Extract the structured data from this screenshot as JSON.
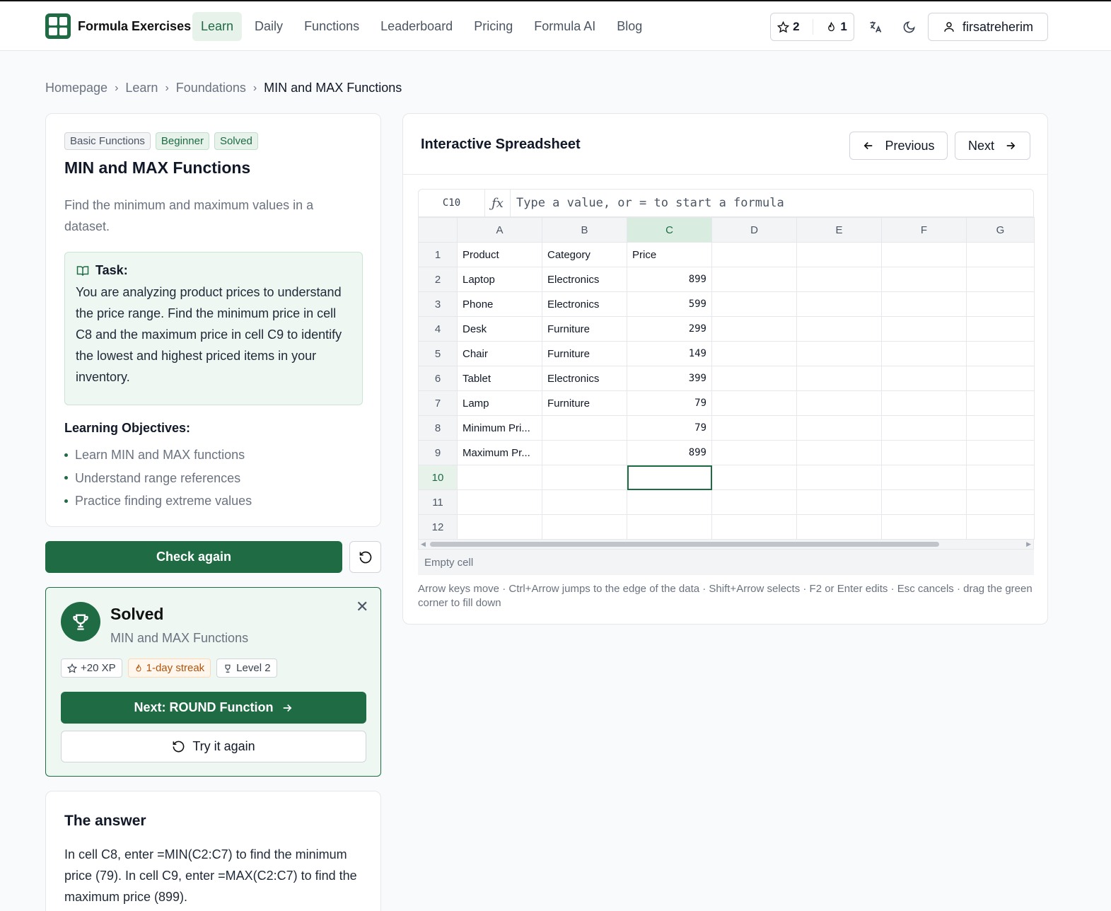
{
  "brand": {
    "name": "Formula Exercises"
  },
  "nav": [
    {
      "label": "Learn",
      "active": true
    },
    {
      "label": "Daily"
    },
    {
      "label": "Functions"
    },
    {
      "label": "Leaderboard"
    },
    {
      "label": "Pricing"
    },
    {
      "label": "Formula AI"
    },
    {
      "label": "Blog"
    }
  ],
  "stats": {
    "xp": "2",
    "streak": "1"
  },
  "user": {
    "name": "firsatreherim"
  },
  "breadcrumb": [
    "Homepage",
    "Learn",
    "Foundations",
    "MIN and MAX Functions"
  ],
  "task": {
    "badges": [
      "Basic Functions",
      "Beginner",
      "Solved"
    ],
    "title": "MIN and MAX Functions",
    "description": "Find the minimum and maximum values in a dataset.",
    "box_heading": "Task:",
    "box_text": "You are analyzing product prices to understand the price range. Find the minimum price in cell C8 and the maximum price in cell C9 to identify the lowest and highest priced items in your inventory.",
    "objectives_title": "Learning Objectives:",
    "objectives": [
      "Learn MIN and MAX functions",
      "Understand range references",
      "Practice finding extreme values"
    ]
  },
  "actions": {
    "check_label": "Check again"
  },
  "solved": {
    "title": "Solved",
    "subtitle": "MIN and MAX Functions",
    "chips": [
      "+20 XP",
      "1-day streak",
      "Level 2"
    ],
    "next_label": "Next: ROUND Function",
    "retry_label": "Try it again"
  },
  "answer": {
    "title": "The answer",
    "text": "In cell C8, enter =MIN(C2:C7) to find the minimum price (79). In cell C9, enter =MAX(C2:C7) to find the maximum price (899)."
  },
  "sheet": {
    "title": "Interactive Spreadsheet",
    "prev_label": "Previous",
    "next_label": "Next",
    "cell_ref": "C10",
    "fx": "ƒx",
    "formula_placeholder": "Type a value, or = to start a formula",
    "columns": [
      "A",
      "B",
      "C",
      "D",
      "E",
      "F",
      "G"
    ],
    "selected_col": "C",
    "selected_row": 10,
    "rows": [
      [
        "Product",
        "Category",
        "Price",
        "",
        "",
        "",
        ""
      ],
      [
        "Laptop",
        "Electronics",
        "899",
        "",
        "",
        "",
        ""
      ],
      [
        "Phone",
        "Electronics",
        "599",
        "",
        "",
        "",
        ""
      ],
      [
        "Desk",
        "Furniture",
        "299",
        "",
        "",
        "",
        ""
      ],
      [
        "Chair",
        "Furniture",
        "149",
        "",
        "",
        "",
        ""
      ],
      [
        "Tablet",
        "Electronics",
        "399",
        "",
        "",
        "",
        ""
      ],
      [
        "Lamp",
        "Furniture",
        "79",
        "",
        "",
        "",
        ""
      ],
      [
        "Minimum Pri...",
        "",
        "79",
        "",
        "",
        "",
        ""
      ],
      [
        "Maximum Pr...",
        "",
        "899",
        "",
        "",
        "",
        ""
      ],
      [
        "",
        "",
        "",
        "",
        "",
        "",
        ""
      ],
      [
        "",
        "",
        "",
        "",
        "",
        "",
        ""
      ],
      [
        "",
        "",
        "",
        "",
        "",
        "",
        ""
      ]
    ],
    "status": "Empty cell",
    "hint": "Arrow keys move · Ctrl+Arrow jumps to the edge of the data · Shift+Arrow selects · F2 or Enter edits · Esc cancels · drag the green corner to fill down"
  }
}
